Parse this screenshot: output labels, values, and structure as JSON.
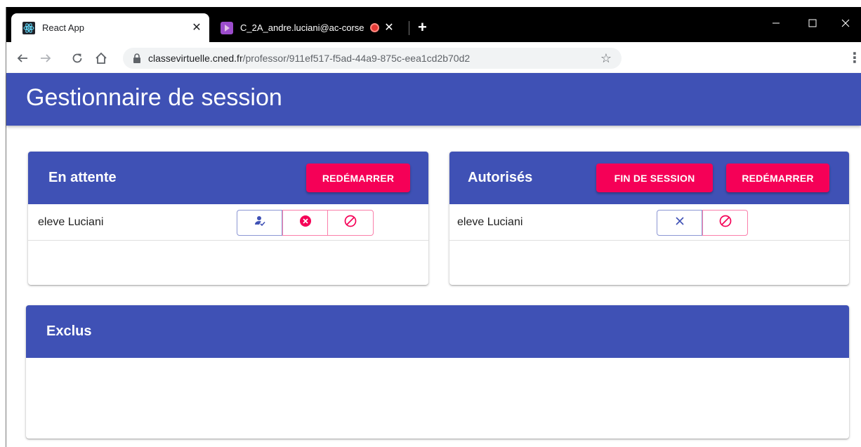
{
  "browser": {
    "tabs": [
      {
        "title": "React App",
        "icon": "react-icon",
        "active": true
      },
      {
        "title": "C_2A_andre.luciani@ac-corse",
        "icon": "app-icon",
        "active": false,
        "recording": true
      }
    ],
    "url_host": "classevirtuelle.cned.fr",
    "url_path": "/professor/911ef517-f5ad-44a9-875c-eea1cd2b70d2"
  },
  "colors": {
    "primary": "#3f51b5",
    "accent": "#f50057"
  },
  "header": {
    "title": "Gestionnaire de session"
  },
  "waiting": {
    "title": "En attente",
    "restart_label": "REDÉMARRER",
    "students": [
      {
        "name": "eleve Luciani"
      }
    ]
  },
  "authorized": {
    "title": "Autorisés",
    "end_session_label": "FIN DE SESSION",
    "restart_label": "REDÉMARRER",
    "students": [
      {
        "name": "eleve Luciani"
      }
    ]
  },
  "excluded": {
    "title": "Exclus"
  }
}
